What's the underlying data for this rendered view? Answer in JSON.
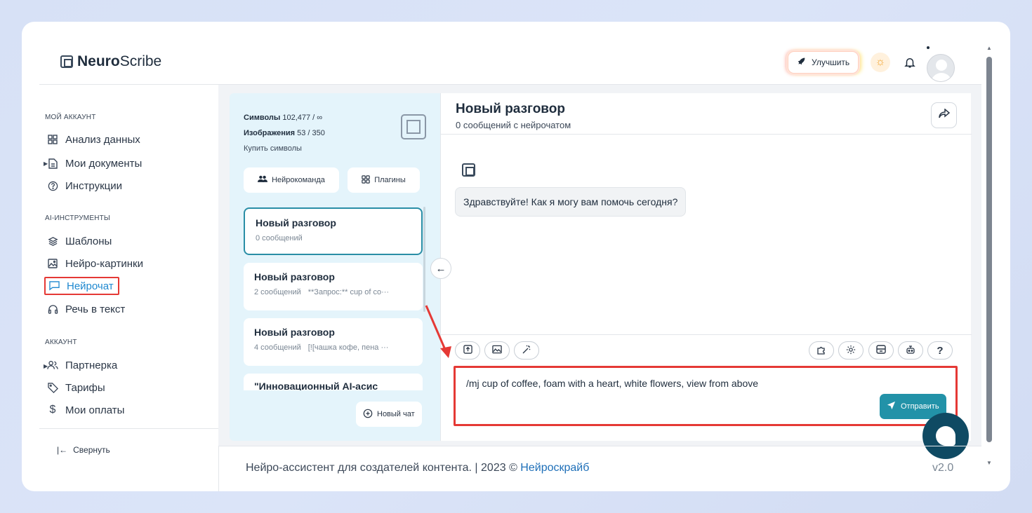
{
  "brand": {
    "name_bold": "Neuro",
    "name_light": "Scribe"
  },
  "header": {
    "upgrade_label": "Улучшить"
  },
  "sidebar": {
    "sections": [
      {
        "title": "МОЙ АККАУНТ",
        "items": [
          {
            "label": "Анализ данных",
            "icon": "grid-icon"
          },
          {
            "label": "Мои документы",
            "icon": "document-icon",
            "expandable": true
          },
          {
            "label": "Инструкции",
            "icon": "help-icon"
          }
        ]
      },
      {
        "title": "AI-ИНСТРУМЕНТЫ",
        "items": [
          {
            "label": "Шаблоны",
            "icon": "layers-icon"
          },
          {
            "label": "Нейро-картинки",
            "icon": "image-icon"
          },
          {
            "label": "Нейрочат",
            "icon": "chat-icon",
            "active": true
          },
          {
            "label": "Речь в текст",
            "icon": "headphones-icon"
          }
        ]
      },
      {
        "title": "АККАУНТ",
        "items": [
          {
            "label": "Партнерка",
            "icon": "users-icon",
            "expandable": true
          },
          {
            "label": "Тарифы",
            "icon": "tag-icon"
          },
          {
            "label": "Мои оплаты",
            "icon": "dollar-icon"
          }
        ]
      }
    ],
    "collapse_label": "Свернуть"
  },
  "quota": {
    "symbols_label": "Символы",
    "symbols_value": "102,477 / ∞",
    "images_label": "Изображения",
    "images_value": "53 / 350",
    "buy_label": "Купить символы"
  },
  "panel": {
    "team_label": "Нейрокоманда",
    "plugins_label": "Плагины",
    "new_chat_label": "Новый чат"
  },
  "conversations": [
    {
      "title": "Новый разговор",
      "count": "0 сообщений",
      "preview": ""
    },
    {
      "title": "Новый разговор",
      "count": "2 сообщений",
      "preview": "**Запрос:** cup of co···"
    },
    {
      "title": "Новый разговор",
      "count": "4 сообщений",
      "preview": "[![чашка кофе, пена ···"
    },
    {
      "title": "\"Инновационный AI-асис",
      "count": "",
      "preview": ""
    }
  ],
  "chat": {
    "title": "Новый разговор",
    "subtitle": "0 сообщений с нейрочатом",
    "greeting": "Здравствуйте! Как я могу вам помочь сегодня?",
    "input_value": "/mj cup of coffee, foam with a heart, white flowers, view from above",
    "send_label": "Отправить",
    "help_label": "?"
  },
  "footer": {
    "text": "Нейро-ассистент для создателей контента.  | 2023 © ",
    "link": "Нейроскрайб",
    "version": "v2.0"
  },
  "colors": {
    "accent": "#2292a8",
    "highlight": "#e53935",
    "link": "#1e6fb8"
  }
}
